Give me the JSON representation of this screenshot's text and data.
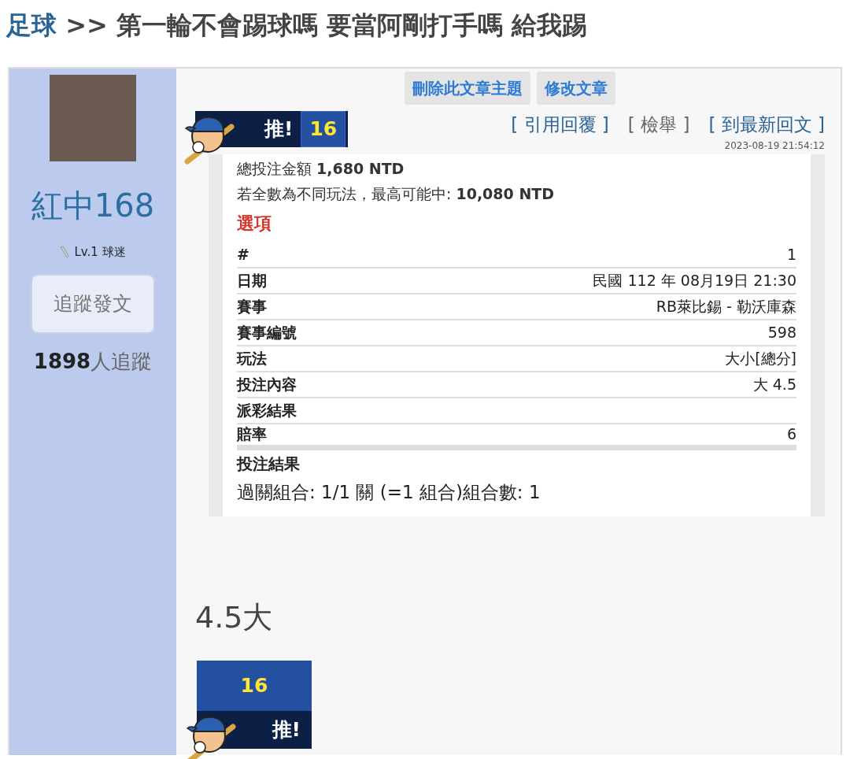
{
  "breadcrumb": {
    "category": "足球",
    "separator": ">>",
    "title": "第一輪不會踢球嗎 要當阿剛打手嗎 給我踢"
  },
  "author": {
    "name": "紅中168",
    "level": "Lv.1 球迷",
    "follow_button": "追蹤發文",
    "follower_count": "1898",
    "follower_label": "人追蹤"
  },
  "post_actions": [
    "刪除此文章主題",
    "修改文章"
  ],
  "push_badge_top": {
    "label": "推!",
    "count": "16"
  },
  "links": [
    {
      "text": "[ 引用回覆 ]",
      "color": "#2a6496"
    },
    {
      "text": "[ 檢舉 ]",
      "color": "#666666"
    },
    {
      "text": "[ 到最新回文 ]",
      "color": "#2a6496"
    }
  ],
  "timestamp": "2023-08-19 21:54:12",
  "bet": {
    "total_label": "總投注金額",
    "total_value": "1,680 NTD",
    "max_label": "若全數為不同玩法，最高可能中:",
    "max_value": "10,080 NTD",
    "options_title": "選項",
    "rows": [
      {
        "label": "#",
        "value": "1"
      },
      {
        "label": "日期",
        "value": "民國 112 年 08月19日 21:30"
      },
      {
        "label": "賽事",
        "value": "RB萊比錫 - 勒沃庫森"
      },
      {
        "label": "賽事編號",
        "value": "598"
      },
      {
        "label": "玩法",
        "value": "大小[總分]"
      },
      {
        "label": "投注內容",
        "value": "大 4.5"
      },
      {
        "label": "派彩結果"
      },
      {
        "label": "賠率",
        "value": "6"
      }
    ],
    "result_title": "投注結果",
    "combo": "過關組合: 1/1 關 (=1 組合)組合數: 1"
  },
  "body": "4.5大",
  "push_badge_bottom": {
    "count": "16",
    "label": "推!"
  }
}
